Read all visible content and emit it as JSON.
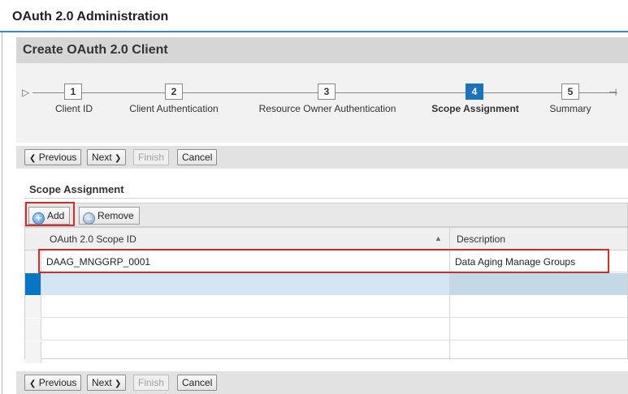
{
  "header": {
    "title": "OAuth 2.0 Administration"
  },
  "panel": {
    "title": "Create OAuth 2.0 Client"
  },
  "roadmap": {
    "steps": [
      {
        "number": "1",
        "label": "Client ID"
      },
      {
        "number": "2",
        "label": "Client Authentication"
      },
      {
        "number": "3",
        "label": "Resource Owner Authentication"
      },
      {
        "number": "4",
        "label": "Scope Assignment"
      },
      {
        "number": "5",
        "label": "Summary"
      }
    ],
    "active_step": 4
  },
  "nav": {
    "previous_label": "Previous",
    "next_label": "Next",
    "finish_label": "Finish",
    "cancel_label": "Cancel"
  },
  "section": {
    "title": "Scope Assignment"
  },
  "table_toolbar": {
    "add_label": "Add",
    "remove_label": "Remove"
  },
  "table": {
    "columns": [
      "OAuth 2.0 Scope ID",
      "Description"
    ],
    "rows": [
      {
        "scope_id": "DAAG_MNGGRP_0001",
        "description": "Data Aging Manage Groups"
      }
    ]
  },
  "colors": {
    "active_step": "#1c73bd",
    "highlight": "#d52b2b",
    "selected_row": "#d2e6f3"
  }
}
